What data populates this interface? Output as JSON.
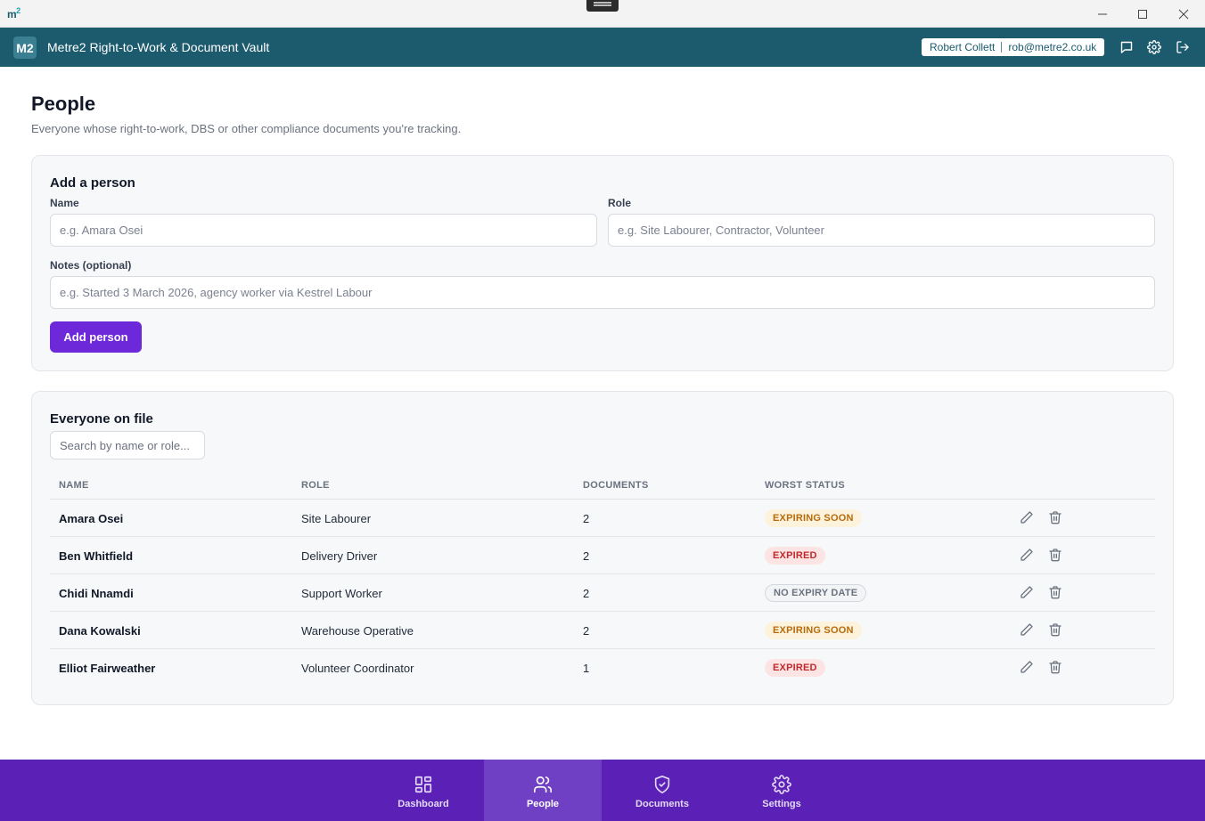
{
  "window": {
    "logo": "m",
    "logo_sup": "2"
  },
  "header": {
    "badge": "M2",
    "title": "Metre2 Right-to-Work & Document Vault",
    "user_name": "Robert Collett",
    "user_email": "rob@metre2.co.uk"
  },
  "page": {
    "title": "People",
    "subtitle": "Everyone whose right-to-work, DBS or other compliance documents you're tracking."
  },
  "add_form": {
    "title": "Add a person",
    "name_label": "Name",
    "name_placeholder": "e.g. Amara Osei",
    "role_label": "Role",
    "role_placeholder": "e.g. Site Labourer, Contractor, Volunteer",
    "notes_label": "Notes (optional)",
    "notes_placeholder": "e.g. Started 3 March 2026, agency worker via Kestrel Labour",
    "submit_label": "Add person"
  },
  "list": {
    "title": "Everyone on file",
    "search_placeholder": "Search by name or role...",
    "columns": [
      "NAME",
      "ROLE",
      "DOCUMENTS",
      "WORST STATUS"
    ],
    "rows": [
      {
        "name": "Amara Osei",
        "role": "Site Labourer",
        "documents": "2",
        "status": "EXPIRING SOON",
        "status_kind": "soon"
      },
      {
        "name": "Ben Whitfield",
        "role": "Delivery Driver",
        "documents": "2",
        "status": "EXPIRED",
        "status_kind": "expired"
      },
      {
        "name": "Chidi Nnamdi",
        "role": "Support Worker",
        "documents": "2",
        "status": "NO EXPIRY DATE",
        "status_kind": "none"
      },
      {
        "name": "Dana Kowalski",
        "role": "Warehouse Operative",
        "documents": "2",
        "status": "EXPIRING SOON",
        "status_kind": "soon"
      },
      {
        "name": "Elliot Fairweather",
        "role": "Volunteer Coordinator",
        "documents": "1",
        "status": "EXPIRED",
        "status_kind": "expired"
      }
    ]
  },
  "nav": {
    "items": [
      {
        "label": "Dashboard",
        "icon": "dashboard-icon"
      },
      {
        "label": "People",
        "icon": "people-icon",
        "active": true
      },
      {
        "label": "Documents",
        "icon": "shield-check-icon"
      },
      {
        "label": "Settings",
        "icon": "gear-icon"
      }
    ]
  },
  "colors": {
    "header": "#1c5a6e",
    "primary": "#6d28d9",
    "nav": "#5b21b6",
    "status_soon": "#b86b0b",
    "status_expired": "#c0292b"
  }
}
